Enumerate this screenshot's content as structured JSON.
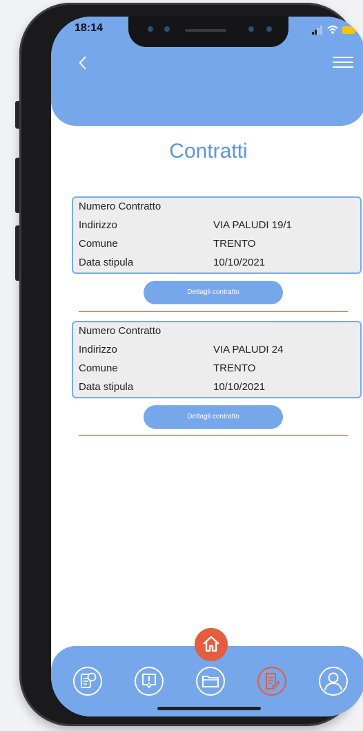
{
  "status_bar": {
    "time": "18:14"
  },
  "header": {
    "back_icon": "chevron-left-icon",
    "menu_icon": "hamburger-menu-icon"
  },
  "page": {
    "title": "Contratti"
  },
  "contracts": [
    {
      "rows": [
        {
          "label": "Numero Contratto",
          "value": ""
        },
        {
          "label": "Indirizzo",
          "value": "VIA PALUDI 19/1"
        },
        {
          "label": "Comune",
          "value": "TRENTO"
        },
        {
          "label": "Data stipula",
          "value": "10/10/2021"
        }
      ],
      "button_label": "Dettagli contratto"
    },
    {
      "rows": [
        {
          "label": "Numero Contratto",
          "value": ""
        },
        {
          "label": "Indirizzo",
          "value": "VIA PALUDI 24"
        },
        {
          "label": "Comune",
          "value": "TRENTO"
        },
        {
          "label": "Data stipula",
          "value": "10/10/2021"
        }
      ],
      "button_label": "Dettagli contratto"
    }
  ],
  "bottom_nav": {
    "home_icon": "home-icon",
    "items": [
      {
        "icon": "bills-icon",
        "active": false
      },
      {
        "icon": "notifications-icon",
        "active": false
      },
      {
        "icon": "folder-icon",
        "active": false
      },
      {
        "icon": "contracts-icon",
        "active": true
      },
      {
        "icon": "profile-icon",
        "active": false
      }
    ]
  },
  "colors": {
    "primary": "#76a7ea",
    "title": "#5b95e4",
    "accent": "#e55d3c",
    "card_bg": "#ededed",
    "divider": "#e5785c"
  }
}
